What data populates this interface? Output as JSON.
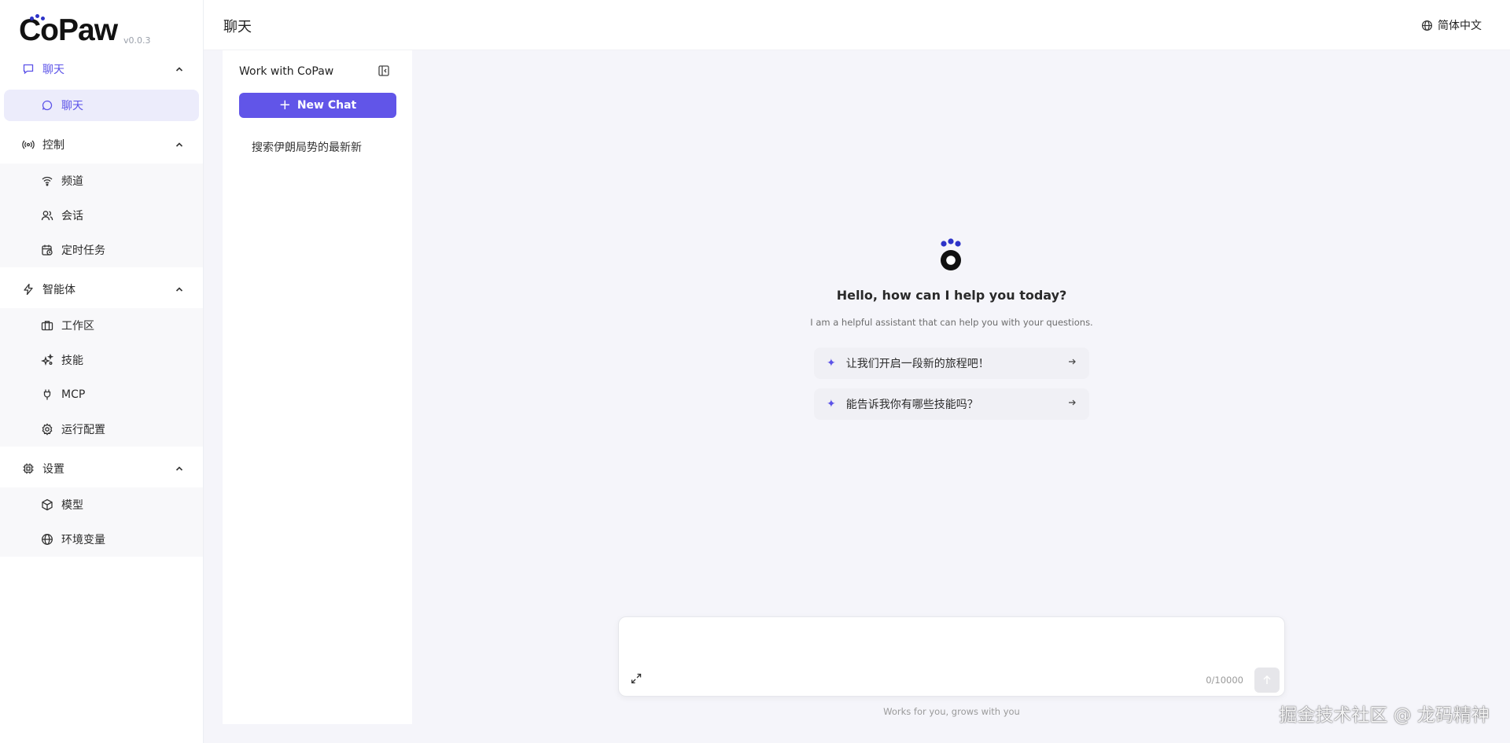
{
  "app": {
    "logo_text": "CoPaw",
    "version": "v0.0.3",
    "accent": "#5b52e8",
    "logo_dot_color": "#2d33c8"
  },
  "header": {
    "title": "聊天",
    "language": "简体中文"
  },
  "sidebar": {
    "groups": [
      {
        "label": "聊天",
        "icon": "message-square-icon",
        "active": true,
        "items": [
          {
            "label": "聊天",
            "icon": "message-circle-icon",
            "active": true
          }
        ]
      },
      {
        "label": "控制",
        "icon": "radio-signal-icon",
        "items": [
          {
            "label": "频道",
            "icon": "wifi-icon"
          },
          {
            "label": "会话",
            "icon": "users-icon"
          },
          {
            "label": "定时任务",
            "icon": "calendar-clock-icon"
          }
        ]
      },
      {
        "label": "智能体",
        "icon": "zap-icon",
        "items": [
          {
            "label": "工作区",
            "icon": "briefcase-icon"
          },
          {
            "label": "技能",
            "icon": "sparkles-icon"
          },
          {
            "label": "MCP",
            "icon": "plug-icon"
          },
          {
            "label": "运行配置",
            "icon": "gear-icon"
          }
        ]
      },
      {
        "label": "设置",
        "icon": "cpu-icon",
        "items": [
          {
            "label": "模型",
            "icon": "cube-icon"
          },
          {
            "label": "环境变量",
            "icon": "globe-icon"
          }
        ]
      }
    ]
  },
  "conversations": {
    "title": "Work with CoPaw",
    "new_chat_label": "New Chat",
    "items": [
      "搜索伊朗局势的最新新"
    ]
  },
  "welcome": {
    "title": "Hello, how can I help you today?",
    "subtitle": "I am a helpful assistant that can help you with your questions.",
    "prompts": [
      "让我们开启一段新的旅程吧！",
      "能告诉我你有哪些技能吗？"
    ]
  },
  "composer": {
    "placeholder": "",
    "counter": "0/10000",
    "footer": "Works for you, grows with you"
  },
  "watermark": "掘金技术社区 @ 龙码精神"
}
